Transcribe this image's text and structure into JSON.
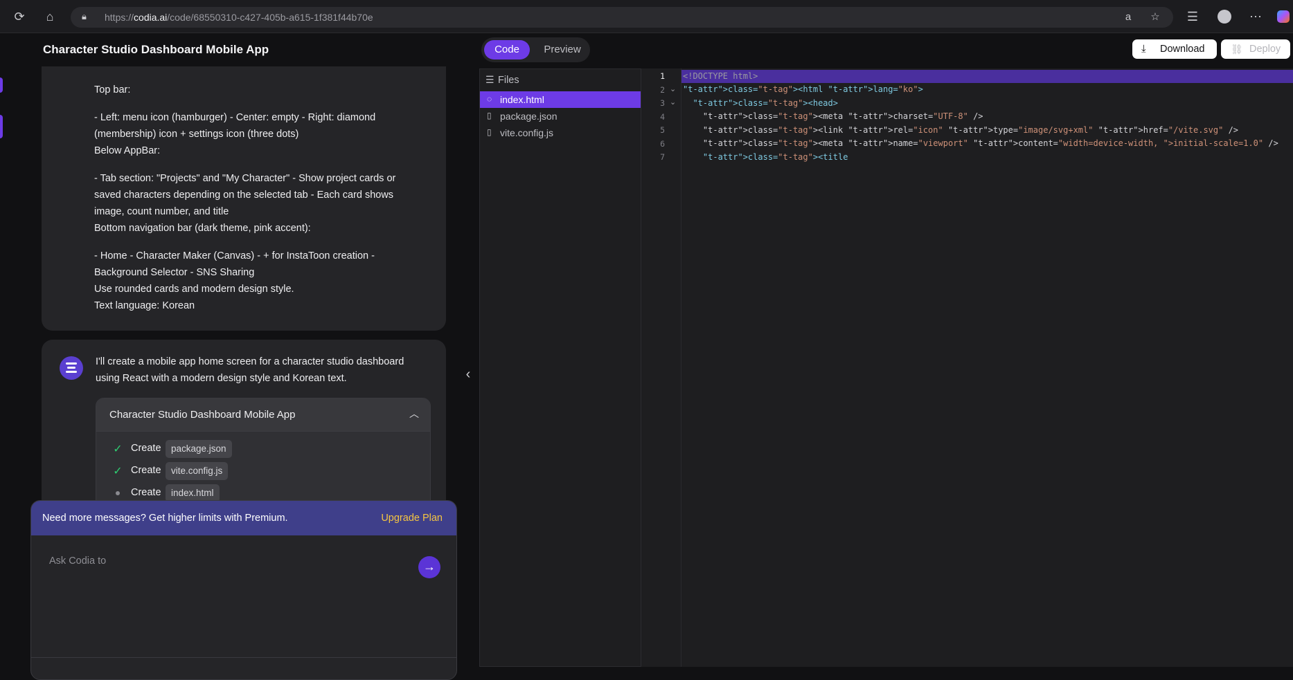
{
  "browser": {
    "url_prefix": "https://",
    "url_host": "codia.ai",
    "url_path": "/code/68550310-c427-405b-a615-1f381f44b70e"
  },
  "app": {
    "title": "Character Studio Dashboard Mobile App"
  },
  "chat": {
    "user_message": [
      "Top bar:",
      "- Left: menu icon (hamburger) - Center: empty - Right: diamond (membership) icon + settings icon (three dots)",
      "Below AppBar:",
      "- Tab section: \"Projects\" and \"My Character\" - Show project cards or saved characters depending on the selected tab - Each card shows image, count number, and title",
      "Bottom navigation bar (dark theme, pink accent):",
      "- Home - Character Maker (Canvas) - + for InstaToon creation - Background Selector - SNS Sharing",
      "Use rounded cards and modern design style.",
      "Text language: Korean"
    ],
    "ai_message": "I'll create a mobile app home screen for a character studio dashboard using React with a modern design style and Korean text.",
    "artifact": {
      "title": "Character Studio Dashboard Mobile App",
      "steps": [
        {
          "verb": "Create",
          "file": "package.json",
          "status": "done"
        },
        {
          "verb": "Create",
          "file": "vite.config.js",
          "status": "done"
        },
        {
          "verb": "Create",
          "file": "index.html",
          "status": "pending"
        }
      ]
    }
  },
  "prompt": {
    "banner_text": "Need more messages? Get higher limits with Premium.",
    "upgrade_label": "Upgrade Plan",
    "placeholder": "Ask Codia to"
  },
  "toolbar": {
    "tab_code": "Code",
    "tab_preview": "Preview",
    "download_label": "Download",
    "deploy_label": "Deploy"
  },
  "files": {
    "header": "Files",
    "items": [
      {
        "name": "index.html",
        "active": true
      },
      {
        "name": "package.json",
        "active": false
      },
      {
        "name": "vite.config.js",
        "active": false
      }
    ]
  },
  "editor": {
    "line_numbers": [
      "1",
      "2",
      "3",
      "4",
      "5",
      "6",
      "7"
    ],
    "lines": [
      "<!DOCTYPE html>",
      "<html lang=\"ko\">",
      "  <head>",
      "    <meta charset=\"UTF-8\" />",
      "    <link rel=\"icon\" type=\"image/svg+xml\" href=\"/vite.svg\" />",
      "    <meta name=\"viewport\" content=\"width=device-width, initial-scale=1.0\" />",
      "    <title"
    ]
  },
  "colors": {
    "accent": "#6d3be6",
    "banner": "#3f3f8a",
    "upgrade": "#f5c542",
    "success": "#2ecc71"
  }
}
